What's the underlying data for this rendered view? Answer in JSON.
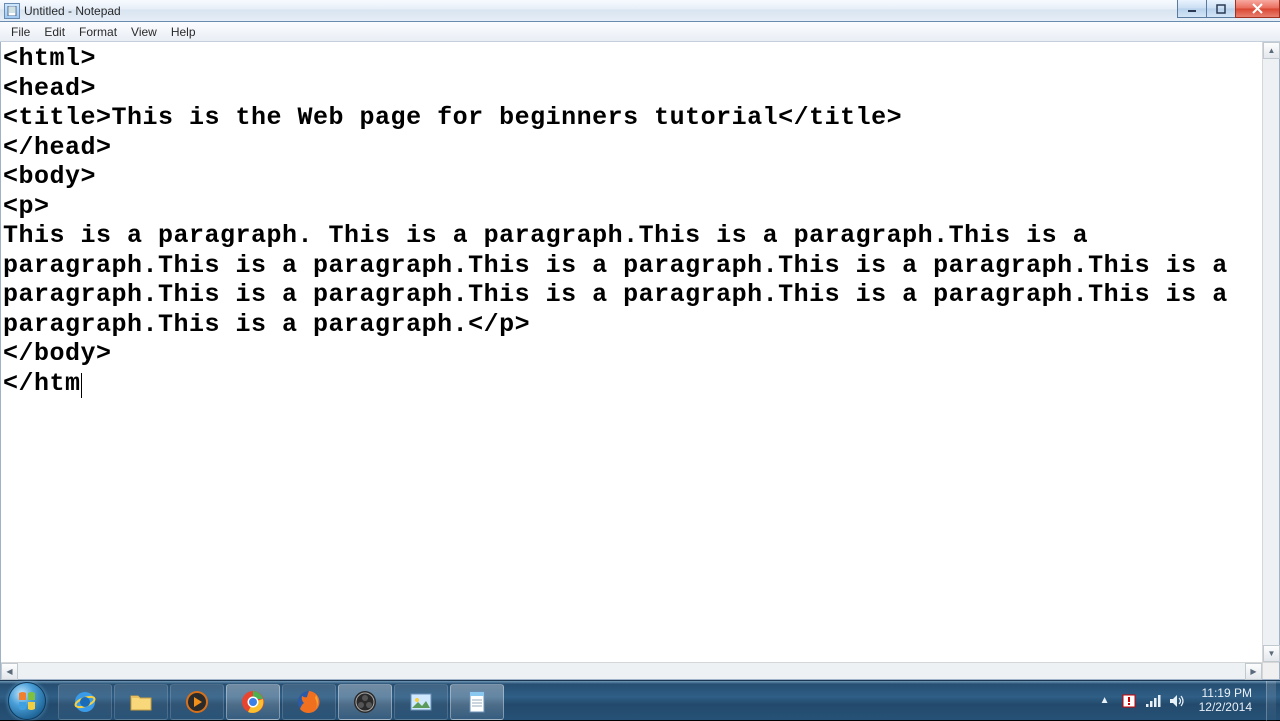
{
  "titlebar": {
    "title": "Untitled - Notepad"
  },
  "menu": {
    "items": [
      "File",
      "Edit",
      "Format",
      "View",
      "Help"
    ]
  },
  "editor": {
    "content": "<html>\n<head>\n<title>This is the Web page for beginners tutorial</title>\n</head>\n<body>\n<p>\nThis is a paragraph. This is a paragraph.This is a paragraph.This is a paragraph.This is a paragraph.This is a paragraph.This is a paragraph.This is a paragraph.This is a paragraph.This is a paragraph.This is a paragraph.This is a paragraph.This is a paragraph.</p>\n</body>\n</htm"
  },
  "taskbar": {
    "pinned": [
      "internet-explorer",
      "file-explorer",
      "windows-media-player",
      "chrome",
      "firefox",
      "obs",
      "photo-viewer",
      "notepad"
    ]
  },
  "systray": {
    "icons": [
      "show-hidden",
      "action-center",
      "network",
      "volume"
    ],
    "time": "11:19 PM",
    "date": "12/2/2014"
  }
}
